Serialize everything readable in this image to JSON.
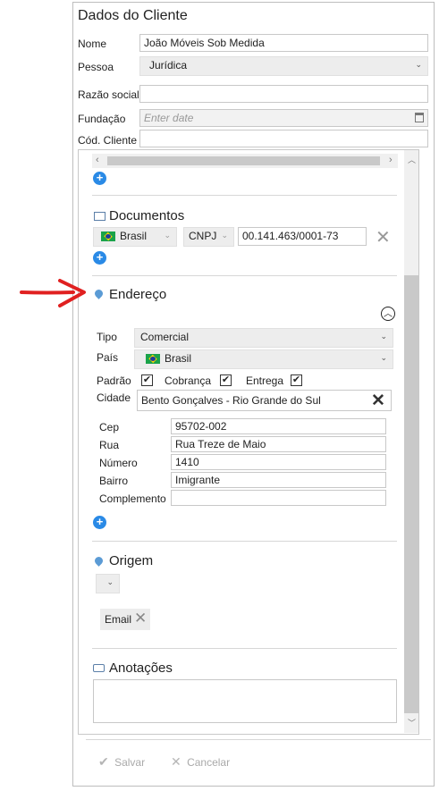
{
  "form": {
    "title": "Dados do Cliente",
    "nome_label": "Nome",
    "nome_value": "João Móveis Sob Medida",
    "pessoa_label": "Pessoa",
    "pessoa_value": "Jurídica",
    "razao_label": "Razão social",
    "razao_value": "",
    "fundacao_label": "Fundação",
    "fundacao_placeholder": "Enter date",
    "cod_label": "Cód. Cliente",
    "cod_value": ""
  },
  "documentos": {
    "title": "Documentos",
    "country": "Brasil",
    "doc_type": "CNPJ",
    "doc_value": "00.141.463/0001-73"
  },
  "endereco": {
    "title": "Endereço",
    "tipo_label": "Tipo",
    "tipo_value": "Comercial",
    "pais_label": "País",
    "pais_value": "Brasil",
    "padrao_label": "Padrão",
    "cobranca_label": "Cobrança",
    "entrega_label": "Entrega",
    "cidade_label": "Cidade",
    "cidade_value": "Bento Gonçalves - Rio Grande do Sul",
    "cep_label": "Cep",
    "cep_value": "95702-002",
    "rua_label": "Rua",
    "rua_value": "Rua Treze de Maio",
    "numero_label": "Número",
    "numero_value": "1410",
    "bairro_label": "Bairro",
    "bairro_value": "Imigrante",
    "complemento_label": "Complemento",
    "complemento_value": ""
  },
  "origem": {
    "title": "Origem",
    "tag": "Email"
  },
  "anotacoes": {
    "title": "Anotações",
    "value": ""
  },
  "actions": {
    "save_label": "Salvar",
    "cancel_label": "Cancelar"
  },
  "icons": {
    "check": "✔",
    "cross": "✕",
    "plus": "+",
    "chevron_down": "⌄"
  },
  "colors": {
    "accent_blue": "#2a8ae6",
    "annotation_arrow": "#e02020"
  }
}
